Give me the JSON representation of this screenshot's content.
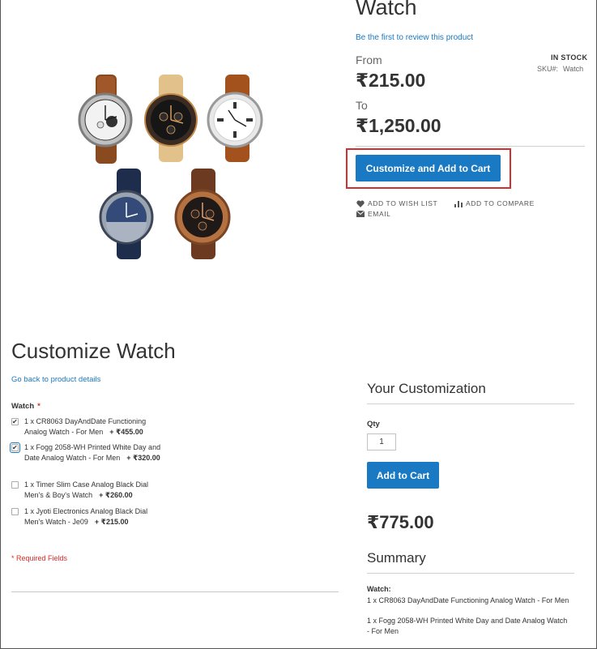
{
  "product": {
    "title": "Watch",
    "review_link": "Be the first to review this product",
    "stock": "IN STOCK",
    "sku_label": "SKU#:",
    "sku_value": "Watch",
    "from_label": "From",
    "from_price": "₹215.00",
    "to_label": "To",
    "to_price": "₹1,250.00",
    "customize_button": "Customize and Add to Cart",
    "wishlist": "ADD TO WISH LIST",
    "compare": "ADD TO COMPARE",
    "email": "EMAIL"
  },
  "customize": {
    "title": "Customize Watch",
    "back_link": "Go back to product details",
    "option_label": "Watch",
    "required_mark": "*",
    "options": [
      {
        "text": "1 x CR8063 DayAndDate Functioning Analog Watch - For Men",
        "price": "+ ₹455.00",
        "checked": true
      },
      {
        "text": "1 x Fogg 2058-WH Printed White Day and Date Analog Watch - For Men",
        "price": "+ ₹320.00",
        "checked": true
      },
      {
        "text": "1 x Timer Slim Case Analog Black Dial Men's & Boy's Watch",
        "price": "+ ₹260.00",
        "checked": false
      },
      {
        "text": "1 x Jyoti Electronics Analog Black Dial Men's Watch - Je09",
        "price": "+ ₹215.00",
        "checked": false
      }
    ],
    "required_note": "* Required Fields"
  },
  "your_customization": {
    "title": "Your Customization",
    "qty_label": "Qty",
    "qty_value": "1",
    "add_to_cart": "Add to Cart",
    "total": "₹775.00",
    "summary_title": "Summary",
    "summary_label": "Watch:",
    "summary_items": [
      "1 x CR8063 DayAndDate Functioning Analog Watch - For Men",
      "1 x Fogg 2058-WH Printed White Day and Date Analog Watch - For Men"
    ]
  },
  "colors": {
    "primary": "#1979c3",
    "highlight": "#d32f2f",
    "required": "#e02b27"
  }
}
